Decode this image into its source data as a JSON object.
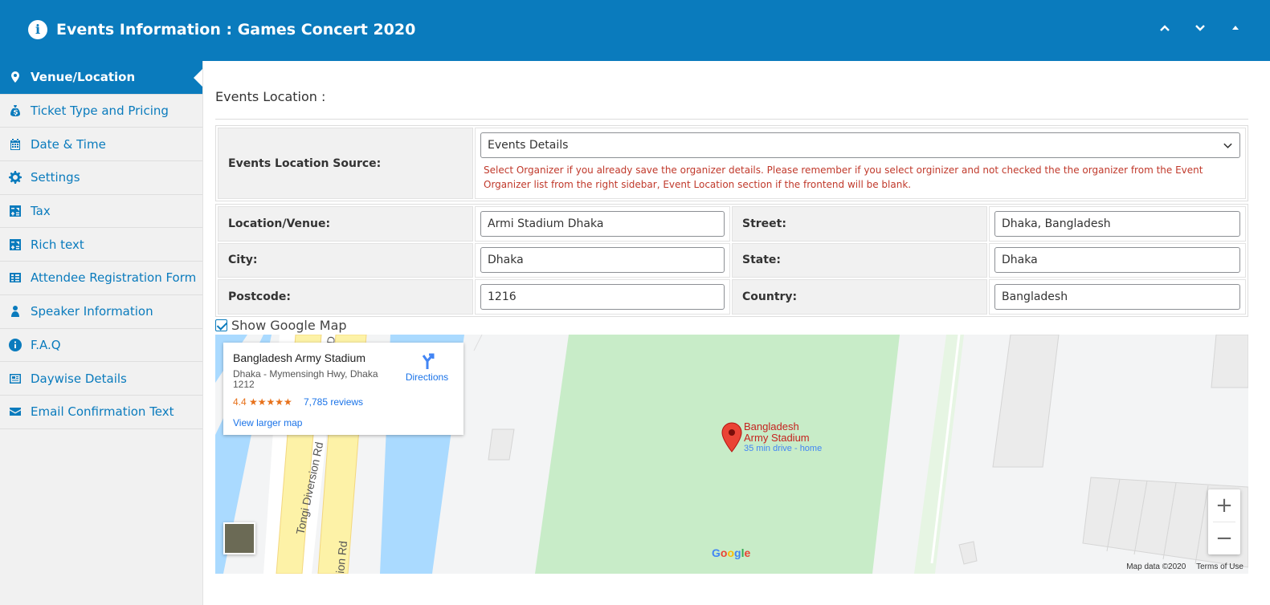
{
  "header": {
    "title": "Events Information : Games Concert 2020",
    "info_icon": "info-icon",
    "buttons": [
      "chevron-up-icon",
      "chevron-down-icon",
      "triangle-up-icon"
    ]
  },
  "sidebar": {
    "items": [
      {
        "label": "Venue/Location",
        "icon": "map-pin-icon",
        "active": true
      },
      {
        "label": "Ticket Type and Pricing",
        "icon": "money-bag-icon"
      },
      {
        "label": "Date & Time",
        "icon": "calendar-icon"
      },
      {
        "label": "Settings",
        "icon": "gear-icon"
      },
      {
        "label": "Tax",
        "icon": "tax-icon"
      },
      {
        "label": "Rich text",
        "icon": "rich-text-icon"
      },
      {
        "label": "Attendee Registration Form",
        "icon": "table-icon"
      },
      {
        "label": "Speaker Information",
        "icon": "person-icon"
      },
      {
        "label": "F.A.Q",
        "icon": "info-icon"
      },
      {
        "label": "Daywise Details",
        "icon": "id-card-icon"
      },
      {
        "label": "Email Confirmation Text",
        "icon": "envelope-icon"
      }
    ]
  },
  "main": {
    "section_title": "Events Location :",
    "source": {
      "label": "Events Location Source:",
      "value": "Events Details",
      "note": "Select Organizer if you already save the organizer details. Please remember if you select orginizer and not checked the the organizer from the Event Organizer list from the right sidebar, Event Location section if the frontend will be blank."
    },
    "fields": {
      "venue": {
        "label": "Location/Venue:",
        "value": "Armi Stadium Dhaka"
      },
      "street": {
        "label": "Street:",
        "value": "Dhaka, Bangladesh"
      },
      "city": {
        "label": "City:",
        "value": "Dhaka"
      },
      "state": {
        "label": "State:",
        "value": "Dhaka"
      },
      "postcode": {
        "label": "Postcode:",
        "value": "1216"
      },
      "country": {
        "label": "Country:",
        "value": "Bangladesh"
      }
    },
    "show_map": {
      "label": "Show Google Map",
      "checked": true
    }
  },
  "map": {
    "card": {
      "name": "Bangladesh Army Stadium",
      "address": "Dhaka - Mymensingh Hwy, Dhaka 1212",
      "rating": "4.4 ★★★★★",
      "reviews": "7,785 reviews",
      "directions": "Directions",
      "larger": "View larger map"
    },
    "pin_label_1": "Bangladesh",
    "pin_label_2": "Army Stadium",
    "pin_sub": "35 min drive - home",
    "road_1": "Tongi Diversion Rd",
    "road_2": "ion Rd",
    "road_3": "D",
    "zoom_in": "+",
    "zoom_out": "−",
    "logo": "Google",
    "attribution": "Map data ©2020",
    "terms": "Terms of Use",
    "colors": {
      "water": "#aadaff",
      "park": "#c8ecc8",
      "road": "#fdf2a7"
    }
  }
}
